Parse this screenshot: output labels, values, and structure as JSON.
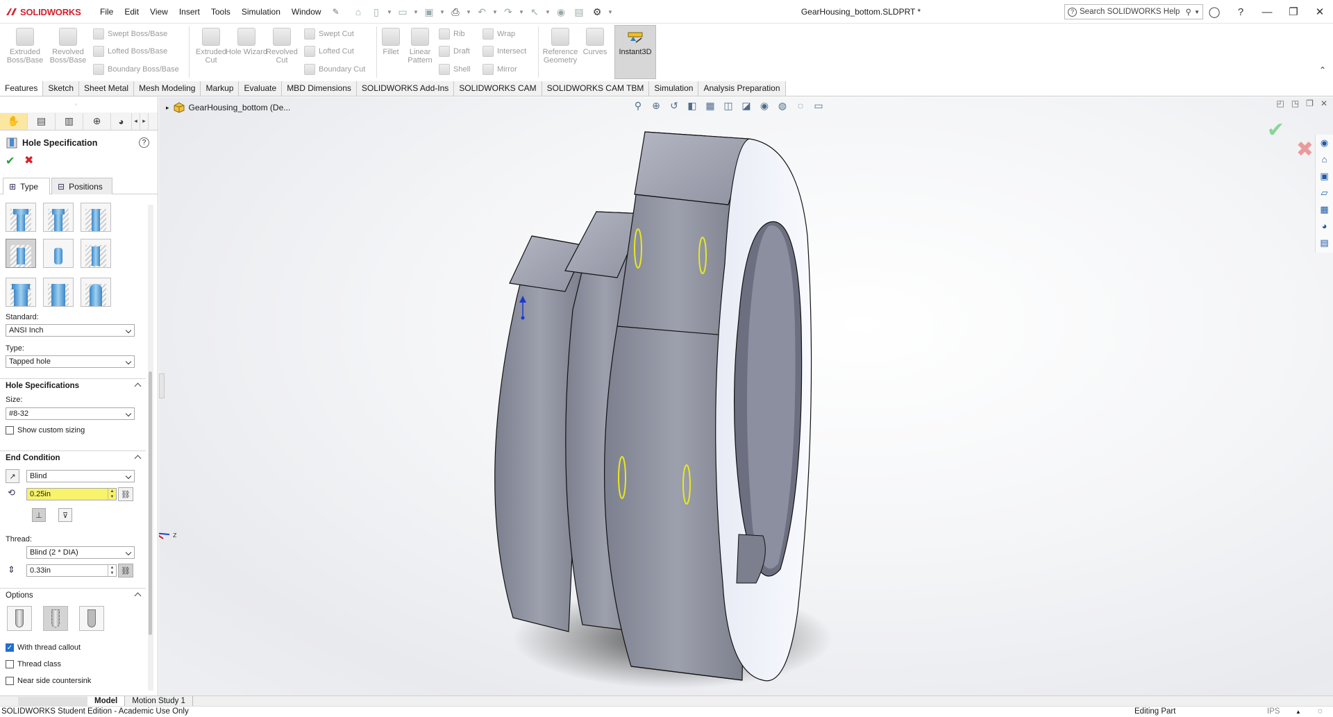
{
  "app": {
    "brand": "SOLIDWORKS",
    "document_title": "GearHousing_bottom.SLDPRT *",
    "menu": [
      "File",
      "Edit",
      "View",
      "Insert",
      "Tools",
      "Simulation",
      "Window"
    ],
    "search_placeholder": "Search SOLIDWORKS Help",
    "accent_color": "#d3202d"
  },
  "ribbon": {
    "big_buttons": [
      {
        "label": "Extruded Boss/Base"
      },
      {
        "label": "Revolved Boss/Base"
      },
      {
        "label": "Extruded Cut"
      },
      {
        "label": "Hole Wizard"
      },
      {
        "label": "Revolved Cut"
      },
      {
        "label": "Fillet"
      },
      {
        "label": "Linear Pattern"
      },
      {
        "label": "Reference Geometry"
      },
      {
        "label": "Curves"
      },
      {
        "label": "Instant3D"
      }
    ],
    "small_buttons": [
      {
        "label": "Swept Boss/Base"
      },
      {
        "label": "Lofted Boss/Base"
      },
      {
        "label": "Boundary Boss/Base"
      },
      {
        "label": "Swept Cut"
      },
      {
        "label": "Lofted Cut"
      },
      {
        "label": "Boundary Cut"
      },
      {
        "label": "Rib"
      },
      {
        "label": "Draft"
      },
      {
        "label": "Shell"
      },
      {
        "label": "Wrap"
      },
      {
        "label": "Intersect"
      },
      {
        "label": "Mirror"
      }
    ]
  },
  "command_tabs": [
    "Features",
    "Sketch",
    "Sheet Metal",
    "Mesh Modeling",
    "Markup",
    "Evaluate",
    "MBD Dimensions",
    "SOLIDWORKS Add-Ins",
    "SOLIDWORKS CAM",
    "SOLIDWORKS CAM TBM",
    "Simulation",
    "Analysis Preparation"
  ],
  "property_manager": {
    "title": "Hole Specification",
    "tabs": {
      "type": "Type",
      "positions": "Positions"
    },
    "standard_label": "Standard:",
    "standard_value": "ANSI Inch",
    "type_label": "Type:",
    "type_value": "Tapped hole",
    "hole_specs": {
      "header": "Hole Specifications",
      "size_label": "Size:",
      "size_value": "#8-32",
      "custom_sizing": "Show custom sizing"
    },
    "end_condition": {
      "header": "End Condition",
      "condition": "Blind",
      "depth": "0.25in",
      "thread_label": "Thread:",
      "thread_value": "Blind (2 * DIA)",
      "thread_depth": "0.33in"
    },
    "options": {
      "header": "Options",
      "with_thread_callout": "With thread callout",
      "with_thread_callout_checked": true,
      "thread_class": "Thread class",
      "thread_class_checked": false,
      "near_side_countersink": "Near side countersink",
      "near_side_countersink_checked": false
    }
  },
  "viewport": {
    "tree_item": "GearHousing_bottom (De...",
    "model_color": "#9a9daa",
    "highlight_color": "#e8e820"
  },
  "bottom_tabs": [
    "Model",
    "Motion Study 1"
  ],
  "status": {
    "left": "SOLIDWORKS Student Edition - Academic Use Only",
    "mode": "Editing Part",
    "units": "IPS"
  }
}
